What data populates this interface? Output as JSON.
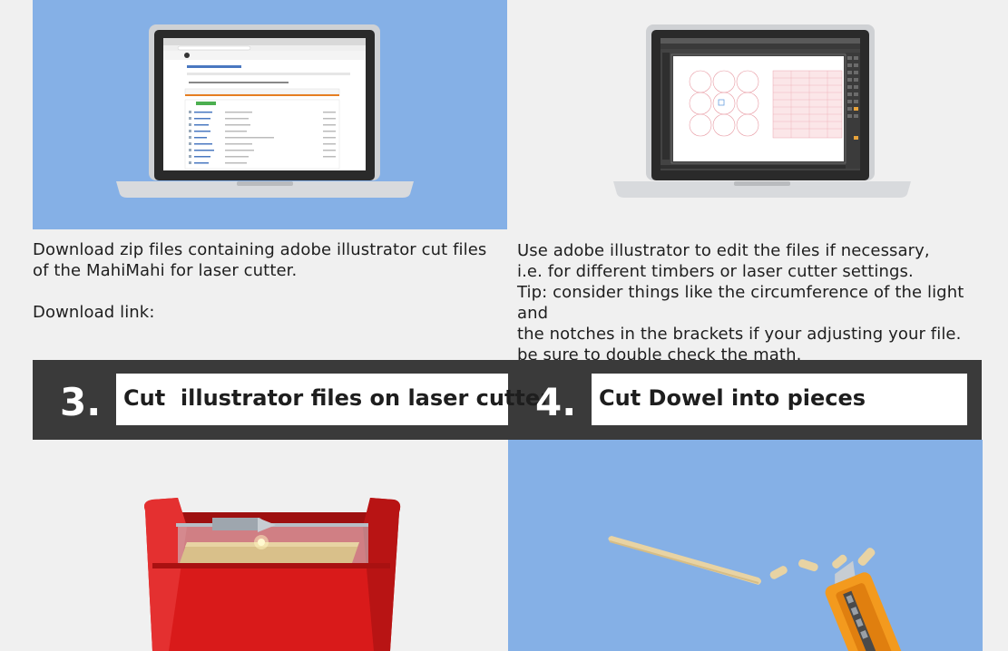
{
  "steps": {
    "download": {
      "lines": [
        "Download zip files containing adobe illustrator cut files",
        "of the MahiMahi for laser cutter.",
        "",
        "Download link:"
      ]
    },
    "edit": {
      "lines": [
        "Use adobe illustrator to edit the files if necessary,",
        "i.e. for different timbers or laser cutter settings.",
        "Tip: consider things like the circumference of the light and",
        "the notches in the brackets if your adjusting your file.",
        "be sure to double check the math."
      ]
    },
    "step3": {
      "number": "3.",
      "title": "Cut  illustrator files on laser cutter"
    },
    "step4": {
      "number": "4.",
      "title": "Cut Dowel into pieces"
    }
  },
  "illustrations": [
    {
      "name": "laptop-github",
      "icon": "laptop-with-github-page"
    },
    {
      "name": "laptop-illustrator",
      "icon": "laptop-with-illustrator"
    },
    {
      "name": "laser-cutter",
      "icon": "red-laser-cutter"
    },
    {
      "name": "dowel-cutting",
      "icon": "dowel-and-box-cutter"
    }
  ],
  "colors": {
    "panel_blue": "#85b0e6",
    "banner_dark": "#3a3a3a",
    "laser_red": "#d91a1a",
    "cutter_orange": "#f39a1e",
    "dowel_tan": "#e8d3a3"
  }
}
